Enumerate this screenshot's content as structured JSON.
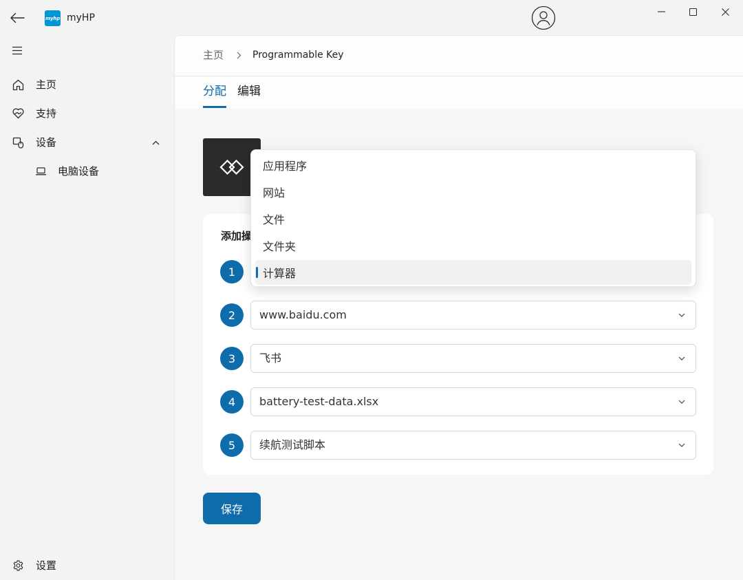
{
  "window": {
    "app_name": "myHP",
    "logo_text": "myhp",
    "back_icon": "back-arrow-icon",
    "profile_icon": "profile-icon",
    "controls": [
      "minimize-icon",
      "maximize-icon",
      "close-icon"
    ]
  },
  "sidebar": {
    "menu_icon": "hamburger-icon",
    "items": [
      {
        "label": "主页",
        "icon": "home-icon"
      },
      {
        "label": "支持",
        "icon": "support-icon"
      },
      {
        "label": "设备",
        "icon": "device-icon",
        "expanded": true
      }
    ],
    "sub_items": [
      {
        "label": "电脑设备",
        "icon": "laptop-icon"
      }
    ],
    "settings": {
      "label": "设置",
      "icon": "gear-icon"
    }
  },
  "breadcrumb": {
    "home": "主页",
    "separator_icon": "chevron-right-icon",
    "current": "Programmable Key"
  },
  "tabs": [
    {
      "label": "分配",
      "active": true
    },
    {
      "label": "编辑",
      "active": false
    }
  ],
  "key_tile": {
    "icon": "programmable-key-icon"
  },
  "card": {
    "title": "添加操",
    "rows": [
      {
        "number": "1"
      },
      {
        "number": "2",
        "value": "www.baidu.com"
      },
      {
        "number": "3",
        "value": "飞书"
      },
      {
        "number": "4",
        "value": "battery-test-data.xlsx"
      },
      {
        "number": "5",
        "value": "续航测试脚本"
      }
    ]
  },
  "dropdown_menu": {
    "options": [
      "应用程序",
      "网站",
      "文件",
      "文件夹",
      "计算器"
    ],
    "selected": "计算器"
  },
  "save_label": "保存",
  "colors": {
    "accent": "#0f6cab",
    "logo": "#0096d6",
    "tile": "#2b2b2b"
  }
}
